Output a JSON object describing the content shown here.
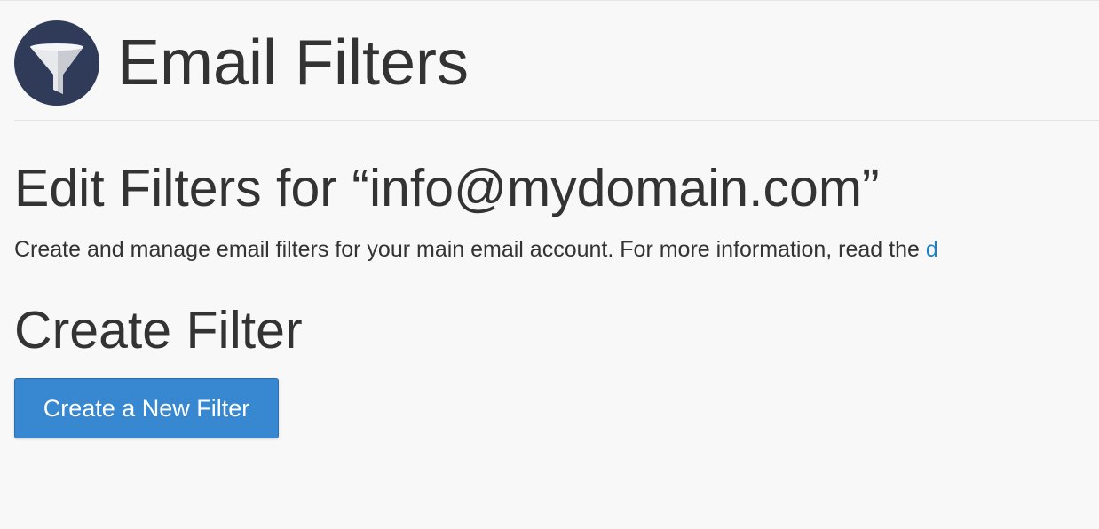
{
  "header": {
    "title": "Email Filters",
    "icon": "funnel-icon",
    "icon_background": "#2f3b59"
  },
  "edit_section": {
    "heading": "Edit Filters for “info@mydomain.com”",
    "description": "Create and manage email filters for your main email account. For more information, read the ",
    "doc_link_text": "d"
  },
  "create_section": {
    "heading": "Create Filter",
    "button_label": "Create a New Filter"
  },
  "colors": {
    "page_background": "#f8f8f9",
    "primary_button": "#3788d0",
    "link": "#1a7fc7",
    "text": "#333333"
  }
}
